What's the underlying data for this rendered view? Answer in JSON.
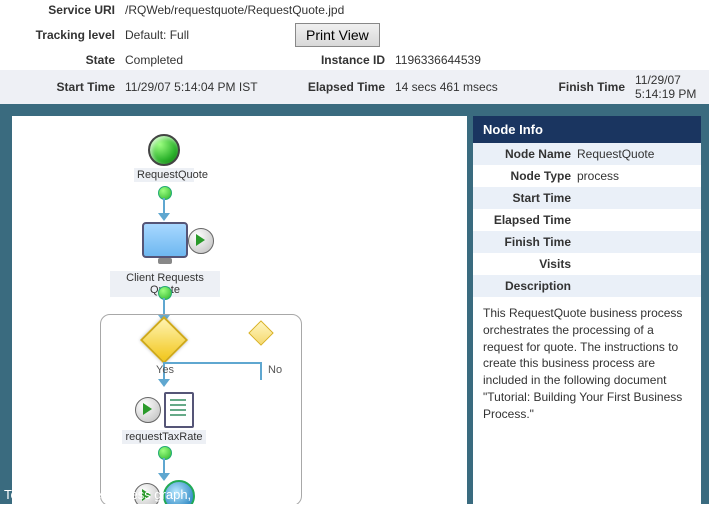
{
  "header": {
    "service_uri_label": "Service URI",
    "service_uri": "/RQWeb/requestquote/RequestQuote.jpd",
    "tracking_label": "Tracking level",
    "tracking": "Default: Full",
    "print_view": "Print View",
    "state_label": "State",
    "state": "Completed",
    "instance_label": "Instance ID",
    "instance": "1196336644539",
    "start_label": "Start Time",
    "start": "11/29/07 5:14:04 PM IST",
    "elapsed_label": "Elapsed Time",
    "elapsed": "14 secs 461 msecs",
    "finish_label": "Finish Time",
    "finish": "11/29/07 5:14:19 PM"
  },
  "graph": {
    "start_node": "RequestQuote",
    "client_request": "Client Requests Quote",
    "yes": "Yes",
    "no": "No",
    "tax_rate": "requestTaxRate",
    "hint": "To pan within the process graph, alt+click and drag. To zoom in, ctrl+click; to"
  },
  "info": {
    "title": "Node Info",
    "rows": {
      "name_label": "Node Name",
      "name": "RequestQuote",
      "type_label": "Node Type",
      "type": "process",
      "start_label": "Start Time",
      "start": "",
      "elapsed_label": "Elapsed Time",
      "elapsed": "",
      "finish_label": "Finish Time",
      "finish": "",
      "visits_label": "Visits",
      "visits": "",
      "desc_label": "Description",
      "desc": ""
    },
    "description": "This RequestQuote business process orchestrates the processing of a request for quote. The instructions to create this business process are included in the following document \"Tutorial: Building Your First Business Process.\""
  }
}
